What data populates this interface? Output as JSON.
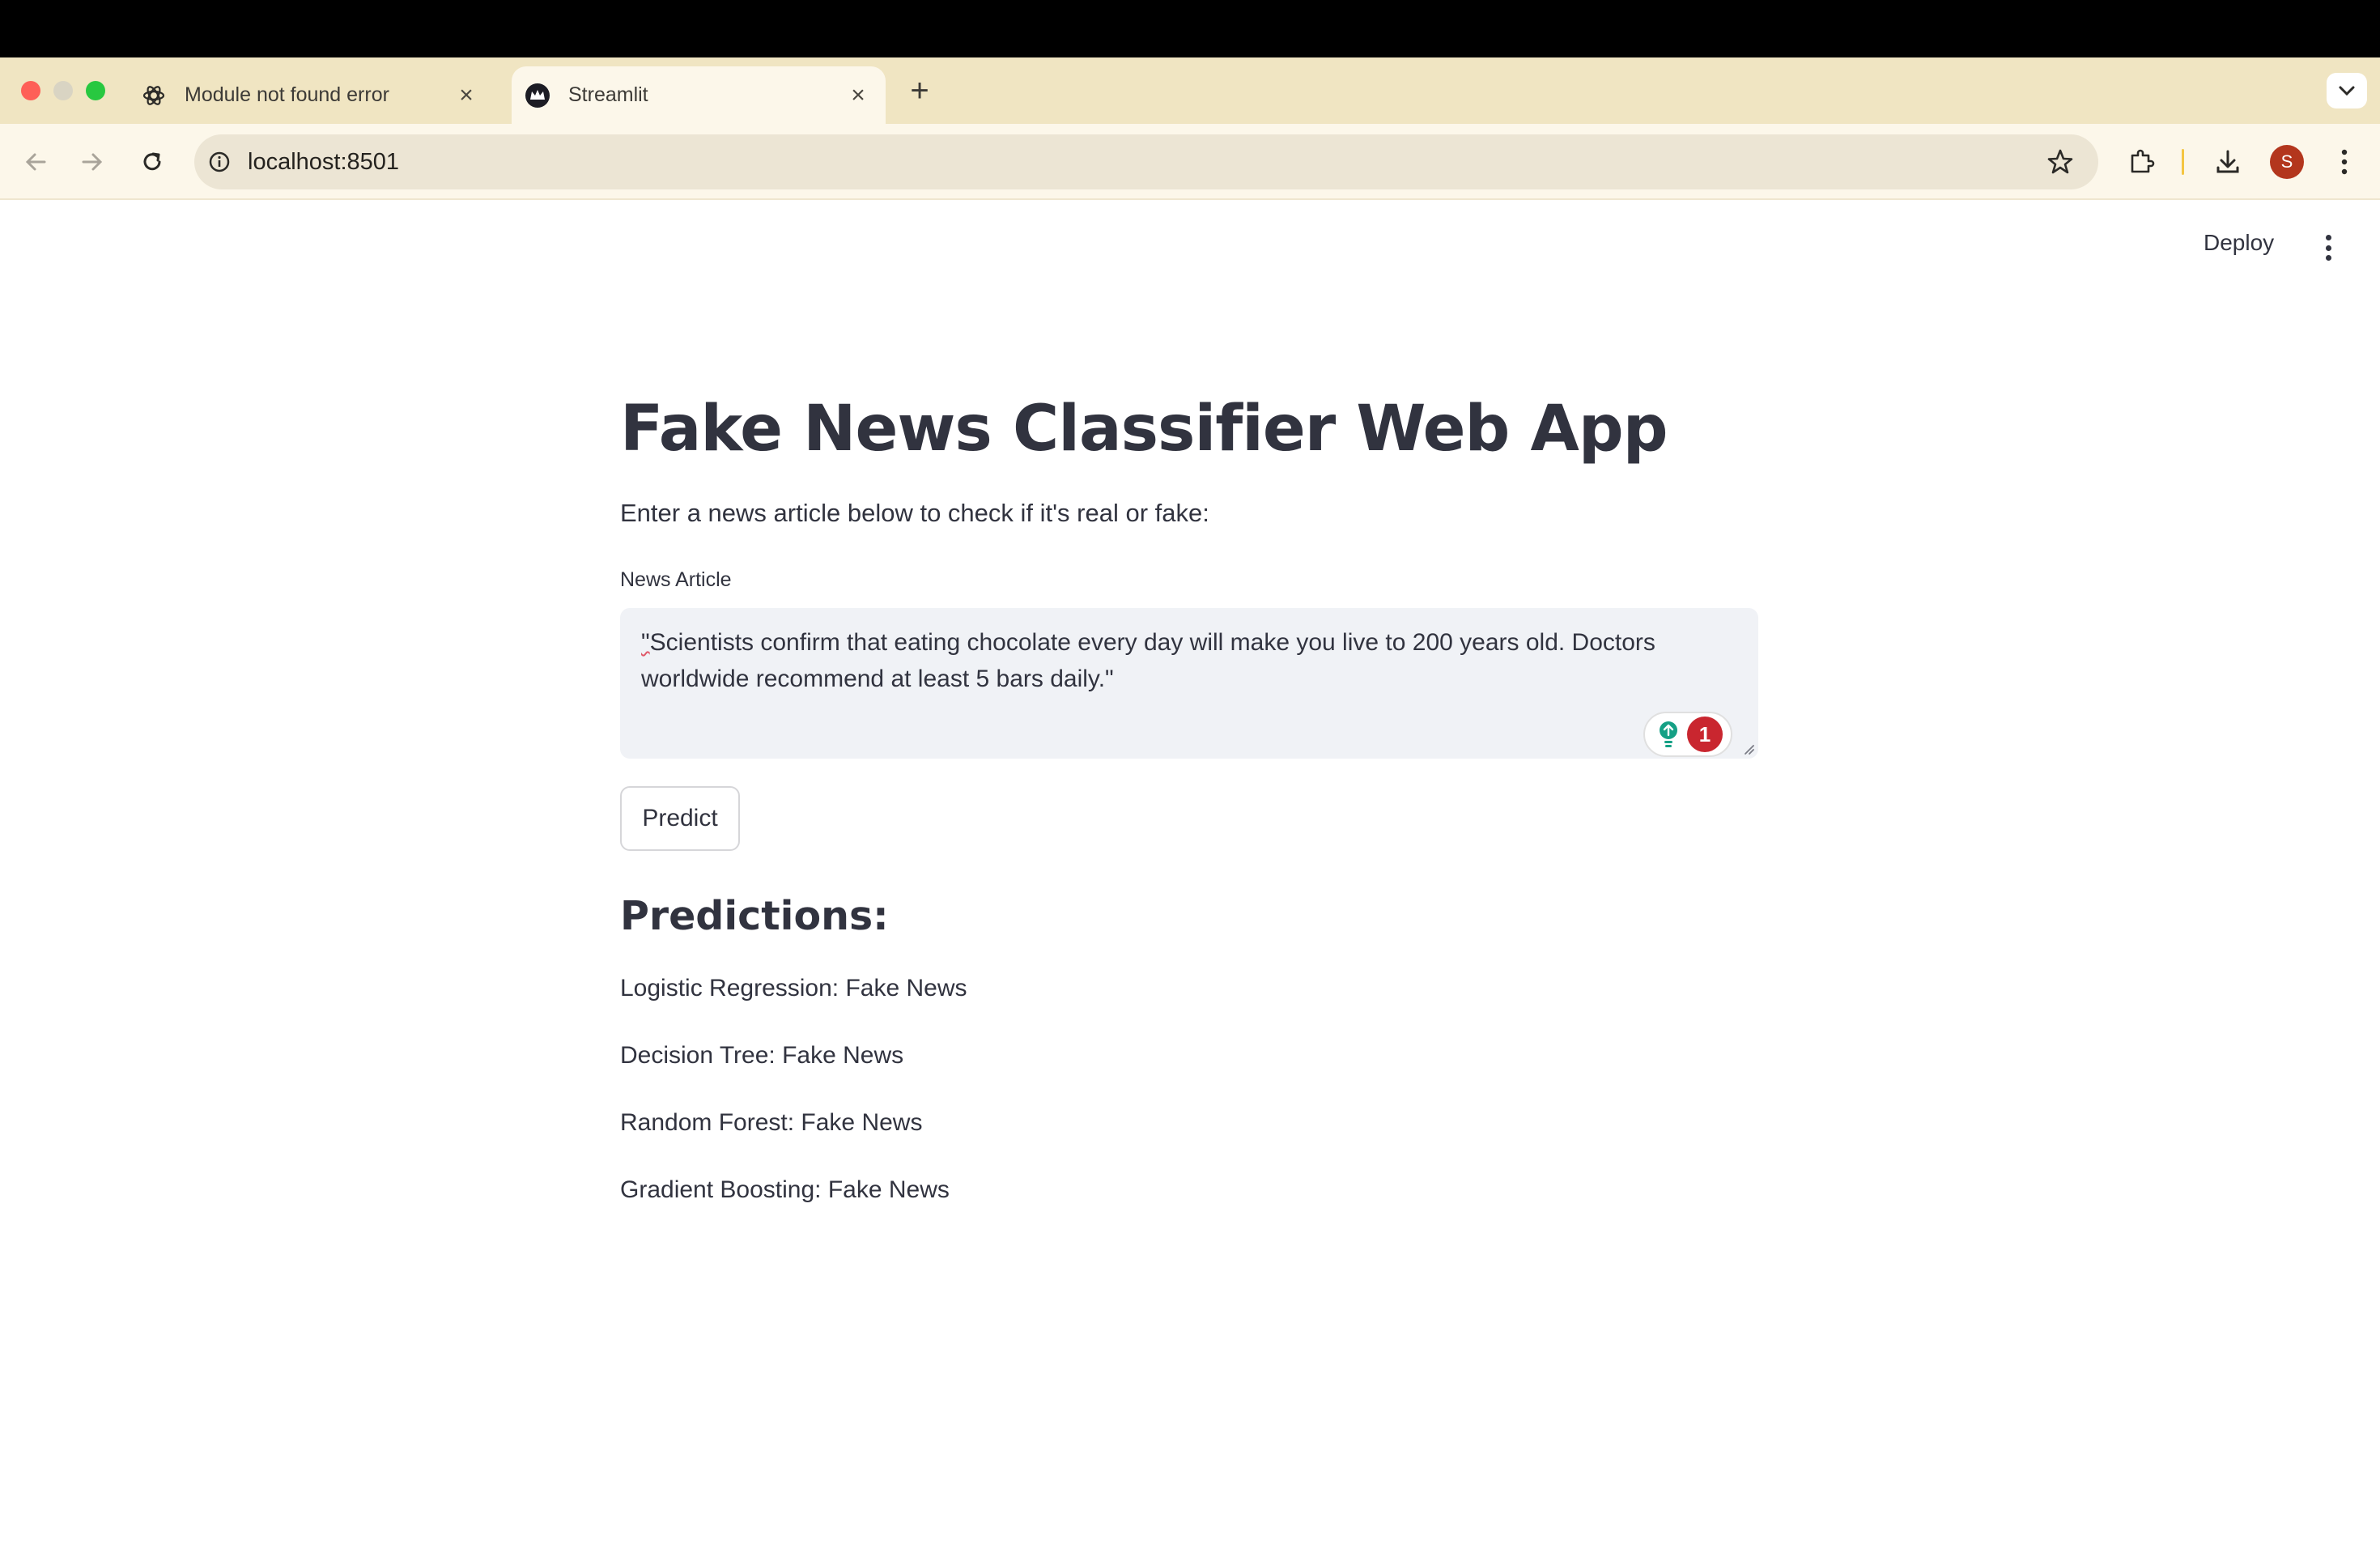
{
  "browser": {
    "tabs": [
      {
        "title": "Module not found error",
        "icon": "openai-icon",
        "active": false
      },
      {
        "title": "Streamlit",
        "icon": "streamlit-crown-icon",
        "active": true
      }
    ],
    "new_tab_label": "+",
    "url": "localhost:8501",
    "profile_initial": "S"
  },
  "app": {
    "deploy_label": "Deploy",
    "title": "Fake News Classifier Web App",
    "intro": "Enter a news article below to check if it's real or fake:",
    "textarea": {
      "label": "News Article",
      "value_quote": "\"",
      "value_rest": "Scientists confirm that eating chocolate every day will make you live to 200 years old. Doctors worldwide recommend at least 5 bars daily.\"",
      "grammar_count": "1"
    },
    "predict_label": "Predict",
    "predictions_heading": "Predictions:",
    "predictions": [
      "Logistic Regression: Fake News",
      "Decision Tree: Fake News",
      "Random Forest: Fake News",
      "Gradient Boosting: Fake News"
    ]
  },
  "colors": {
    "tab_strip": "#f0e5c2",
    "toolbar": "#fcf7ea",
    "text": "#31333f",
    "textarea_bg": "#f0f2f6",
    "badge_red": "#c9262f",
    "profile": "#b3361d"
  }
}
